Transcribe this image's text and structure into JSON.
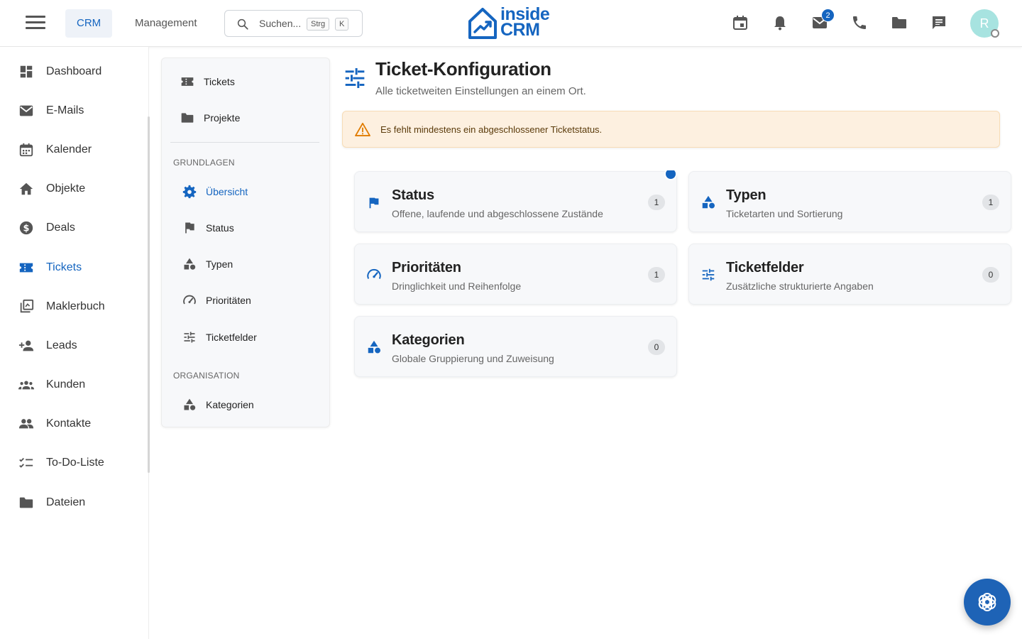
{
  "topbar": {
    "tabs": [
      {
        "label": "CRM",
        "active": true
      },
      {
        "label": "Management",
        "active": false
      }
    ],
    "search": {
      "placeholder": "Suchen...",
      "shortcut": [
        "Strg",
        "K"
      ]
    },
    "logo": {
      "line1": "inside",
      "line2": "CRM"
    },
    "icons": [
      "calendar-icon",
      "bell-icon",
      "mail-icon",
      "phone-icon",
      "folder-icon",
      "chat-icon"
    ],
    "mail_badge": "2",
    "avatar_initial": "R"
  },
  "sidebar": {
    "items": [
      {
        "label": "Dashboard",
        "icon": "dashboard-icon"
      },
      {
        "label": "E-Mails",
        "icon": "mail-icon"
      },
      {
        "label": "Kalender",
        "icon": "calendar-icon"
      },
      {
        "label": "Objekte",
        "icon": "home-icon"
      },
      {
        "label": "Deals",
        "icon": "dollar-icon"
      },
      {
        "label": "Tickets",
        "icon": "ticket-icon",
        "active": true
      },
      {
        "label": "Maklerbuch",
        "icon": "library-icon"
      },
      {
        "label": "Leads",
        "icon": "person-add-icon"
      },
      {
        "label": "Kunden",
        "icon": "groups-icon"
      },
      {
        "label": "Kontakte",
        "icon": "people-icon"
      },
      {
        "label": "To-Do-Liste",
        "icon": "checklist-icon"
      },
      {
        "label": "Dateien",
        "icon": "folder-icon"
      }
    ]
  },
  "subnav": {
    "top_items": [
      {
        "label": "Tickets",
        "icon": "ticket-icon"
      },
      {
        "label": "Projekte",
        "icon": "folder-icon"
      }
    ],
    "sections": [
      {
        "title": "GRUNDLAGEN",
        "items": [
          {
            "label": "Übersicht",
            "icon": "gear-icon",
            "active": true
          },
          {
            "label": "Status",
            "icon": "flag-icon"
          },
          {
            "label": "Typen",
            "icon": "category-icon"
          },
          {
            "label": "Prioritäten",
            "icon": "speed-icon"
          },
          {
            "label": "Ticketfelder",
            "icon": "tune-icon"
          }
        ]
      },
      {
        "title": "ORGANISATION",
        "items": [
          {
            "label": "Kategorien",
            "icon": "category-icon"
          }
        ]
      }
    ]
  },
  "main": {
    "title": "Ticket-Konfiguration",
    "subtitle": "Alle ticketweiten Einstellungen an einem Ort.",
    "alert": "Es fehlt mindestens ein abgeschlossener Ticketstatus.",
    "cards": [
      {
        "title": "Status",
        "description": "Offene, laufende und abgeschlossene Zustände",
        "count": "1",
        "icon": "flag-icon"
      },
      {
        "title": "Typen",
        "description": "Ticketarten und Sortierung",
        "count": "1",
        "icon": "category-icon"
      },
      {
        "title": "Prioritäten",
        "description": "Dringlichkeit und Reihenfolge",
        "count": "1",
        "icon": "speed-icon"
      },
      {
        "title": "Ticketfelder",
        "description": "Zusätzliche strukturierte Angaben",
        "count": "0",
        "icon": "tune-icon"
      },
      {
        "title": "Kategorien",
        "description": "Globale Gruppierung und Zuweisung",
        "count": "0",
        "icon": "category-icon"
      }
    ]
  },
  "colors": {
    "accent": "#1565c0",
    "alert_bg": "#fdf0e0",
    "alert_icon": "#e07b00"
  }
}
